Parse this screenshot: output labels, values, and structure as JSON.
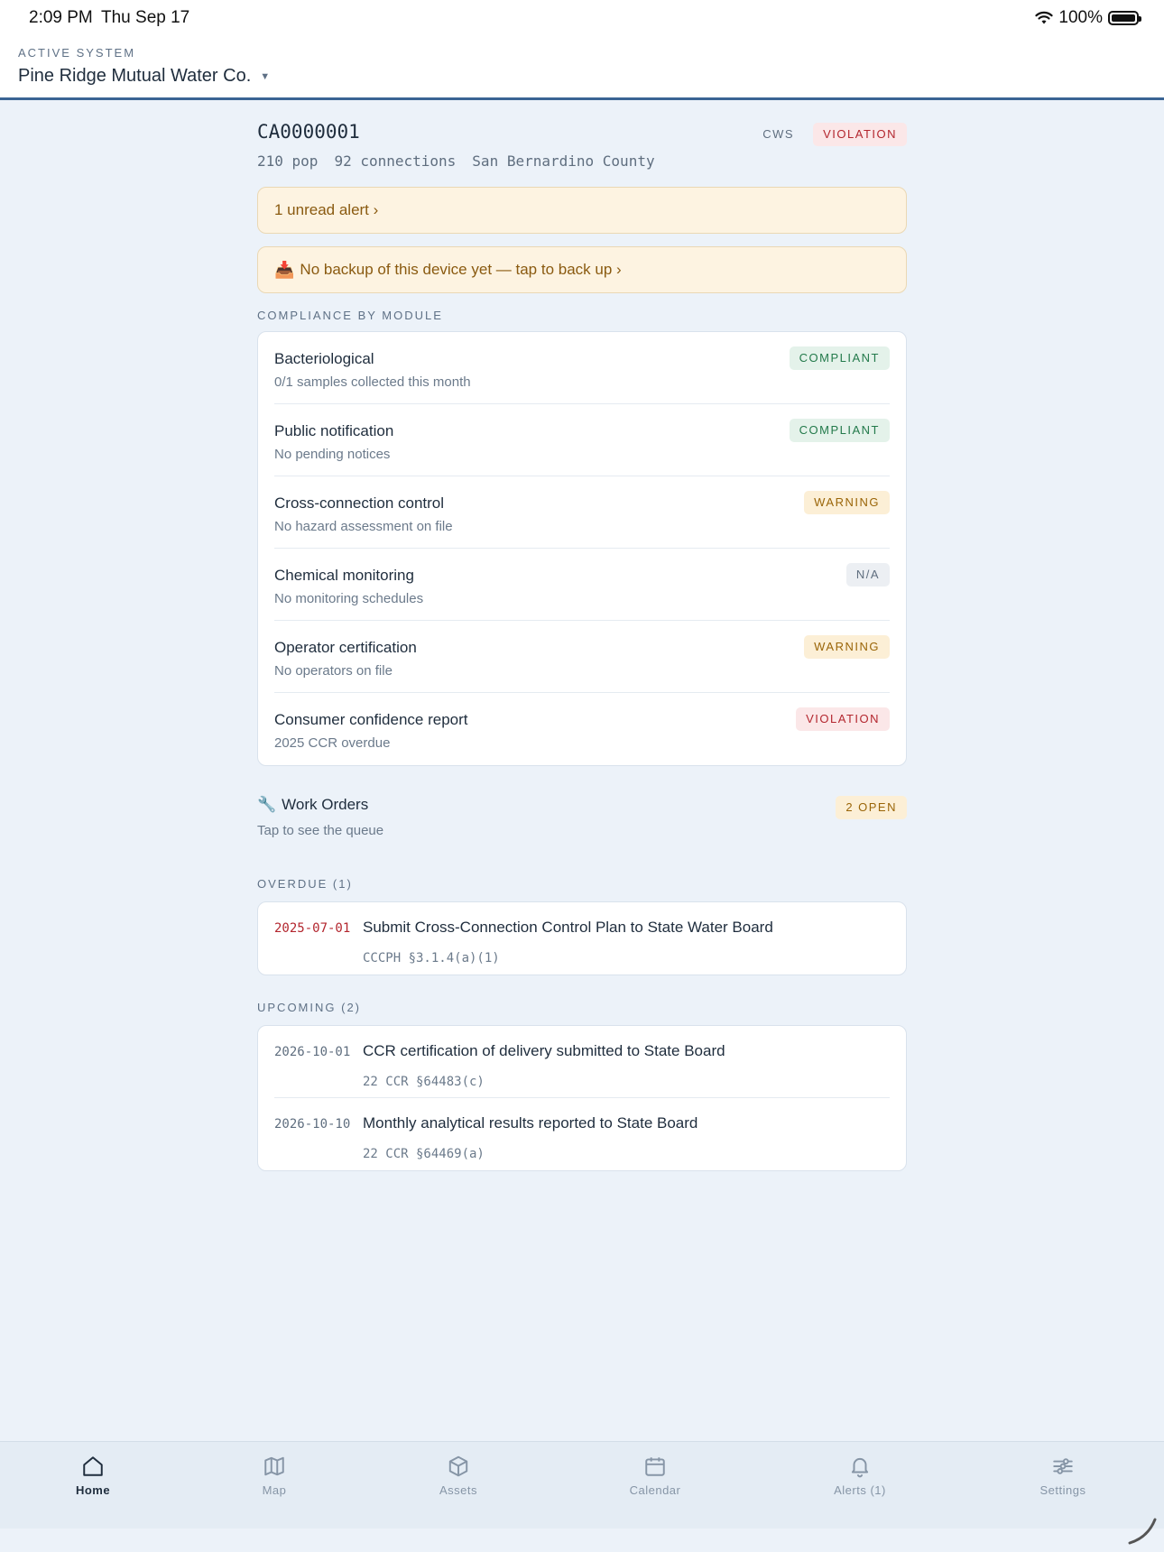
{
  "status_bar": {
    "time": "2:09 PM",
    "date": "Thu Sep 17",
    "battery": "100%"
  },
  "header": {
    "active_label": "ACTIVE SYSTEM",
    "system_name": "Pine Ridge Mutual Water Co."
  },
  "system": {
    "pwsid": "CA0000001",
    "type_tag": "CWS",
    "status_tag": "VIOLATION",
    "population": "210 pop",
    "connections": "92 connections",
    "county": "San Bernardino County"
  },
  "banners": {
    "alert": "1 unread alert ›",
    "backup_icon": "📥",
    "backup": "No backup of this device yet — tap to back up ›"
  },
  "compliance": {
    "label": "COMPLIANCE BY MODULE",
    "modules": [
      {
        "title": "Bacteriological",
        "subtitle": "0/1 samples collected this month",
        "status": "COMPLIANT"
      },
      {
        "title": "Public notification",
        "subtitle": "No pending notices",
        "status": "COMPLIANT"
      },
      {
        "title": "Cross-connection control",
        "subtitle": "No hazard assessment on file",
        "status": "WARNING"
      },
      {
        "title": "Chemical monitoring",
        "subtitle": "No monitoring schedules",
        "status": "N/A"
      },
      {
        "title": "Operator certification",
        "subtitle": "No operators on file",
        "status": "WARNING"
      },
      {
        "title": "Consumer confidence report",
        "subtitle": "2025 CCR overdue",
        "status": "VIOLATION"
      }
    ]
  },
  "work_orders": {
    "icon": "🔧",
    "title": "Work Orders",
    "subtitle": "Tap to see the queue",
    "badge": "2 OPEN"
  },
  "overdue": {
    "label": "OVERDUE (1)",
    "items": [
      {
        "date": "2025-07-01",
        "title": "Submit Cross-Connection Control Plan to State Water Board",
        "citation": "CCCPH §3.1.4(a)(1)"
      }
    ]
  },
  "upcoming": {
    "label": "UPCOMING (2)",
    "items": [
      {
        "date": "2026-10-01",
        "title": "CCR certification of delivery submitted to State Board",
        "citation": "22 CCR §64483(c)"
      },
      {
        "date": "2026-10-10",
        "title": "Monthly analytical results reported to State Board",
        "citation": "22 CCR §64469(a)"
      }
    ]
  },
  "tabs": [
    {
      "label": "Home",
      "icon": "home-icon"
    },
    {
      "label": "Map",
      "icon": "map-icon"
    },
    {
      "label": "Assets",
      "icon": "box-icon"
    },
    {
      "label": "Calendar",
      "icon": "calendar-icon"
    },
    {
      "label": "Alerts (1)",
      "icon": "bell-icon"
    },
    {
      "label": "Settings",
      "icon": "sliders-icon"
    }
  ]
}
